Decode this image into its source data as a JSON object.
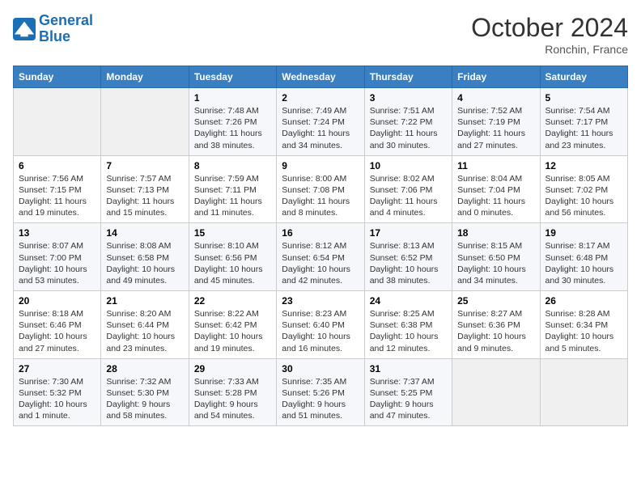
{
  "header": {
    "logo_line1": "General",
    "logo_line2": "Blue",
    "month": "October 2024",
    "location": "Ronchin, France"
  },
  "weekdays": [
    "Sunday",
    "Monday",
    "Tuesday",
    "Wednesday",
    "Thursday",
    "Friday",
    "Saturday"
  ],
  "weeks": [
    [
      {
        "day": "",
        "content": ""
      },
      {
        "day": "",
        "content": ""
      },
      {
        "day": "1",
        "content": "Sunrise: 7:48 AM\nSunset: 7:26 PM\nDaylight: 11 hours and 38 minutes."
      },
      {
        "day": "2",
        "content": "Sunrise: 7:49 AM\nSunset: 7:24 PM\nDaylight: 11 hours and 34 minutes."
      },
      {
        "day": "3",
        "content": "Sunrise: 7:51 AM\nSunset: 7:22 PM\nDaylight: 11 hours and 30 minutes."
      },
      {
        "day": "4",
        "content": "Sunrise: 7:52 AM\nSunset: 7:19 PM\nDaylight: 11 hours and 27 minutes."
      },
      {
        "day": "5",
        "content": "Sunrise: 7:54 AM\nSunset: 7:17 PM\nDaylight: 11 hours and 23 minutes."
      }
    ],
    [
      {
        "day": "6",
        "content": "Sunrise: 7:56 AM\nSunset: 7:15 PM\nDaylight: 11 hours and 19 minutes."
      },
      {
        "day": "7",
        "content": "Sunrise: 7:57 AM\nSunset: 7:13 PM\nDaylight: 11 hours and 15 minutes."
      },
      {
        "day": "8",
        "content": "Sunrise: 7:59 AM\nSunset: 7:11 PM\nDaylight: 11 hours and 11 minutes."
      },
      {
        "day": "9",
        "content": "Sunrise: 8:00 AM\nSunset: 7:08 PM\nDaylight: 11 hours and 8 minutes."
      },
      {
        "day": "10",
        "content": "Sunrise: 8:02 AM\nSunset: 7:06 PM\nDaylight: 11 hours and 4 minutes."
      },
      {
        "day": "11",
        "content": "Sunrise: 8:04 AM\nSunset: 7:04 PM\nDaylight: 11 hours and 0 minutes."
      },
      {
        "day": "12",
        "content": "Sunrise: 8:05 AM\nSunset: 7:02 PM\nDaylight: 10 hours and 56 minutes."
      }
    ],
    [
      {
        "day": "13",
        "content": "Sunrise: 8:07 AM\nSunset: 7:00 PM\nDaylight: 10 hours and 53 minutes."
      },
      {
        "day": "14",
        "content": "Sunrise: 8:08 AM\nSunset: 6:58 PM\nDaylight: 10 hours and 49 minutes."
      },
      {
        "day": "15",
        "content": "Sunrise: 8:10 AM\nSunset: 6:56 PM\nDaylight: 10 hours and 45 minutes."
      },
      {
        "day": "16",
        "content": "Sunrise: 8:12 AM\nSunset: 6:54 PM\nDaylight: 10 hours and 42 minutes."
      },
      {
        "day": "17",
        "content": "Sunrise: 8:13 AM\nSunset: 6:52 PM\nDaylight: 10 hours and 38 minutes."
      },
      {
        "day": "18",
        "content": "Sunrise: 8:15 AM\nSunset: 6:50 PM\nDaylight: 10 hours and 34 minutes."
      },
      {
        "day": "19",
        "content": "Sunrise: 8:17 AM\nSunset: 6:48 PM\nDaylight: 10 hours and 30 minutes."
      }
    ],
    [
      {
        "day": "20",
        "content": "Sunrise: 8:18 AM\nSunset: 6:46 PM\nDaylight: 10 hours and 27 minutes."
      },
      {
        "day": "21",
        "content": "Sunrise: 8:20 AM\nSunset: 6:44 PM\nDaylight: 10 hours and 23 minutes."
      },
      {
        "day": "22",
        "content": "Sunrise: 8:22 AM\nSunset: 6:42 PM\nDaylight: 10 hours and 19 minutes."
      },
      {
        "day": "23",
        "content": "Sunrise: 8:23 AM\nSunset: 6:40 PM\nDaylight: 10 hours and 16 minutes."
      },
      {
        "day": "24",
        "content": "Sunrise: 8:25 AM\nSunset: 6:38 PM\nDaylight: 10 hours and 12 minutes."
      },
      {
        "day": "25",
        "content": "Sunrise: 8:27 AM\nSunset: 6:36 PM\nDaylight: 10 hours and 9 minutes."
      },
      {
        "day": "26",
        "content": "Sunrise: 8:28 AM\nSunset: 6:34 PM\nDaylight: 10 hours and 5 minutes."
      }
    ],
    [
      {
        "day": "27",
        "content": "Sunrise: 7:30 AM\nSunset: 5:32 PM\nDaylight: 10 hours and 1 minute."
      },
      {
        "day": "28",
        "content": "Sunrise: 7:32 AM\nSunset: 5:30 PM\nDaylight: 9 hours and 58 minutes."
      },
      {
        "day": "29",
        "content": "Sunrise: 7:33 AM\nSunset: 5:28 PM\nDaylight: 9 hours and 54 minutes."
      },
      {
        "day": "30",
        "content": "Sunrise: 7:35 AM\nSunset: 5:26 PM\nDaylight: 9 hours and 51 minutes."
      },
      {
        "day": "31",
        "content": "Sunrise: 7:37 AM\nSunset: 5:25 PM\nDaylight: 9 hours and 47 minutes."
      },
      {
        "day": "",
        "content": ""
      },
      {
        "day": "",
        "content": ""
      }
    ]
  ]
}
